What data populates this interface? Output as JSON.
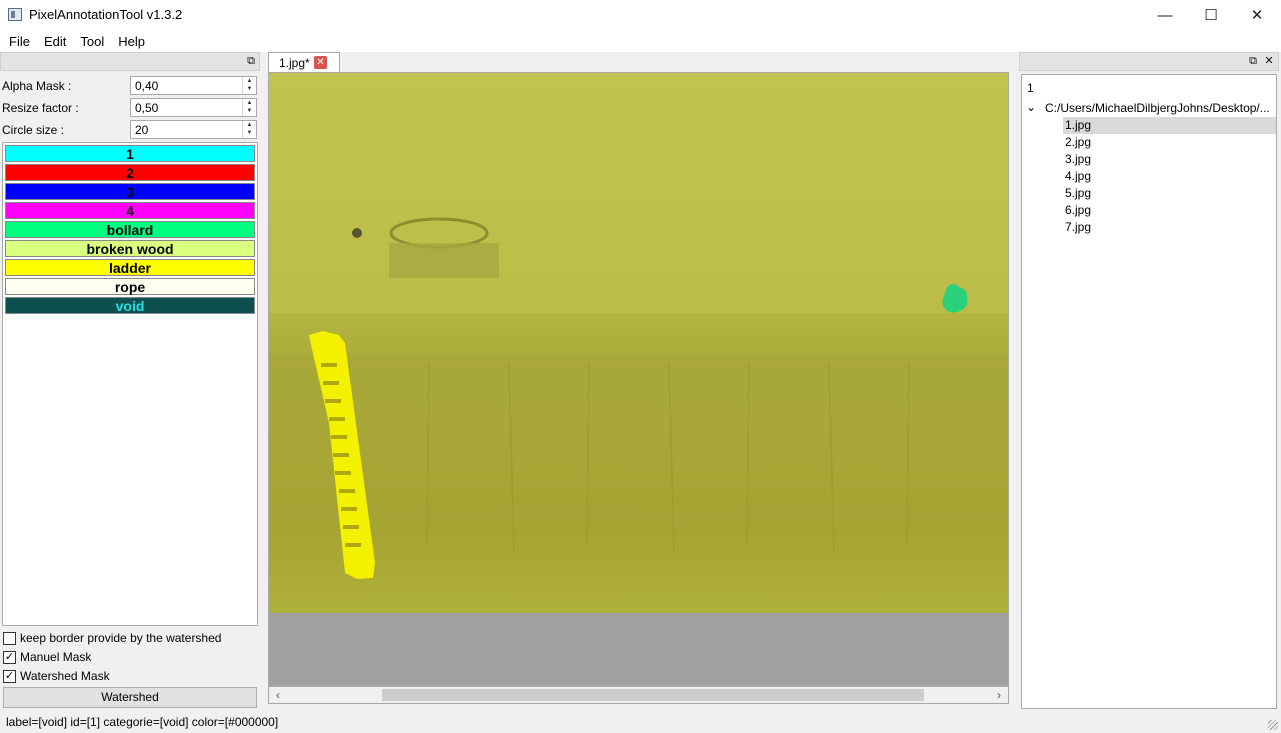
{
  "app": {
    "title": "PixelAnnotationTool v1.3.2"
  },
  "window": {
    "minimize": "—",
    "maximize": "☐",
    "close": "✕"
  },
  "menu": [
    "File",
    "Edit",
    "Tool",
    "Help"
  ],
  "params": {
    "alpha_label": "Alpha Mask :",
    "alpha_value": "0,40",
    "resize_label": "Resize factor :",
    "resize_value": "0,50",
    "circle_label": "Circle size :",
    "circle_value": "20"
  },
  "labels": [
    {
      "name": "1",
      "bg": "#00ffff",
      "fg": "#000000"
    },
    {
      "name": "2",
      "bg": "#ff0000",
      "fg": "#000000"
    },
    {
      "name": "3",
      "bg": "#0000ff",
      "fg": "#000000"
    },
    {
      "name": "4",
      "bg": "#ff00ff",
      "fg": "#000000"
    },
    {
      "name": "bollard",
      "bg": "#00ff80",
      "fg": "#000000"
    },
    {
      "name": "broken wood",
      "bg": "#d9ff80",
      "fg": "#000000"
    },
    {
      "name": "ladder",
      "bg": "#ffff00",
      "fg": "#000000"
    },
    {
      "name": "rope",
      "bg": "#fffff0",
      "fg": "#000000"
    },
    {
      "name": "void",
      "bg": "#0e5050",
      "fg": "#26e0e0"
    }
  ],
  "options": {
    "keep_border": "keep border provide by the watershed",
    "manual_mask": "Manuel Mask",
    "watershed_mask": "Watershed Mask",
    "keep_border_checked": false,
    "manual_mask_checked": true,
    "watershed_mask_checked": true
  },
  "watershed_button": "Watershed",
  "tab": {
    "name": "1.jpg*",
    "close": "✕"
  },
  "tree": {
    "root_label": "1",
    "folder": "C:/Users/MichaelDilbjergJohns/Desktop/...",
    "files": [
      "1.jpg",
      "2.jpg",
      "3.jpg",
      "4.jpg",
      "5.jpg",
      "6.jpg",
      "7.jpg"
    ],
    "selected": "1.jpg"
  },
  "status": "label=[void] id=[1] categorie=[void] color=[#000000]",
  "colors": {
    "mask_overlay": "#bcbc4a",
    "ladder_mask": "#f3f000",
    "bollard_mask": "#2bd07a"
  }
}
